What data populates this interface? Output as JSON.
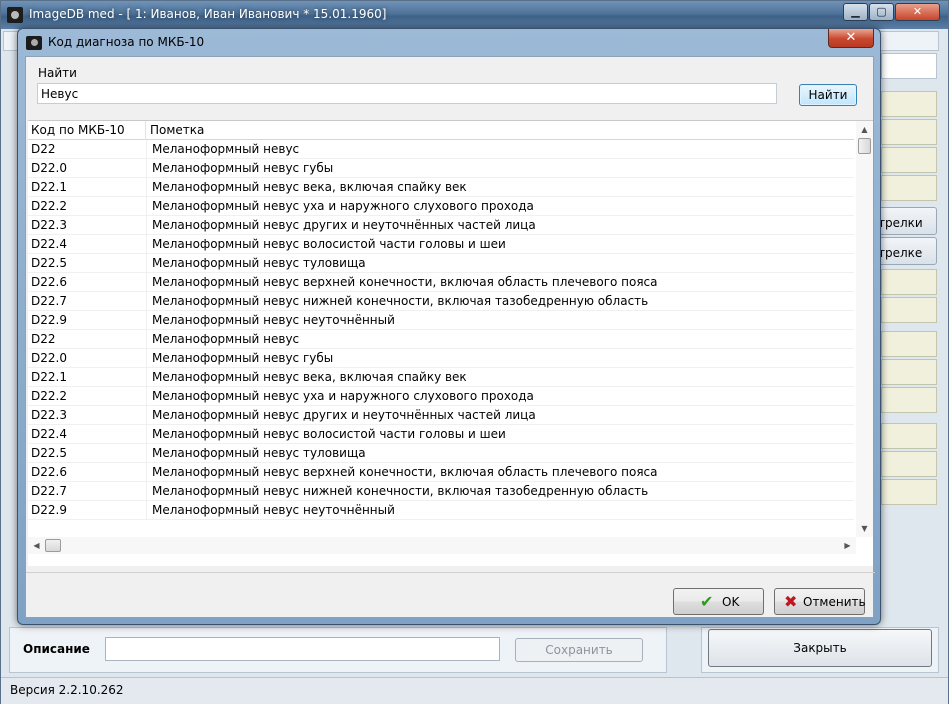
{
  "main_window": {
    "title": "ImageDB med - [ 1: Иванов, Иван Иванович   * 15.01.1960]",
    "minimize_glyph": "▁",
    "maximize_glyph": "▢",
    "close_glyph": "✕",
    "right_labels": [
      "трелки",
      "трелке"
    ],
    "description_label": "Описание",
    "save_button": "Сохранить",
    "close_button": "Закрыть",
    "status": "Версия 2.2.10.262"
  },
  "dialog": {
    "title": "Код диагноза по МКБ-10",
    "close_glyph": "✕",
    "search": {
      "label": "Найти",
      "value": "Невус",
      "button": "Найти"
    },
    "table": {
      "columns": [
        "Код по МКБ-10",
        "Пометка"
      ],
      "rows": [
        {
          "code": "D22",
          "note": "Меланоформный невус"
        },
        {
          "code": "D22.0",
          "note": "Меланоформный невус губы"
        },
        {
          "code": "D22.1",
          "note": "Меланоформный невус века, включая спайку век"
        },
        {
          "code": "D22.2",
          "note": "Меланоформный невус уха и наружного слухового прохода"
        },
        {
          "code": "D22.3",
          "note": "Меланоформный невус других и неуточнённых частей лица"
        },
        {
          "code": "D22.4",
          "note": "Меланоформный невус волосистой части головы и шеи"
        },
        {
          "code": "D22.5",
          "note": "Меланоформный невус туловища"
        },
        {
          "code": "D22.6",
          "note": "Меланоформный невус верхней конечности, включая область плечевого пояса"
        },
        {
          "code": "D22.7",
          "note": "Меланоформный невус нижней конечности, включая тазобедренную область"
        },
        {
          "code": "D22.9",
          "note": "Меланоформный невус неуточнённый"
        },
        {
          "code": "D22",
          "note": "Меланоформный невус"
        },
        {
          "code": "D22.0",
          "note": "Меланоформный невус губы"
        },
        {
          "code": "D22.1",
          "note": "Меланоформный невус века, включая спайку век"
        },
        {
          "code": "D22.2",
          "note": "Меланоформный невус уха и наружного слухового прохода"
        },
        {
          "code": "D22.3",
          "note": "Меланоформный невус других и неуточнённых частей лица"
        },
        {
          "code": "D22.4",
          "note": "Меланоформный невус волосистой части головы и шеи"
        },
        {
          "code": "D22.5",
          "note": "Меланоформный невус туловища"
        },
        {
          "code": "D22.6",
          "note": "Меланоформный невус верхней конечности, включая область плечевого пояса"
        },
        {
          "code": "D22.7",
          "note": "Меланоформный невус нижней конечности, включая тазобедренную область"
        },
        {
          "code": "D22.9",
          "note": "Меланоформный невус неуточнённый"
        }
      ]
    },
    "buttons": {
      "ok": "OK",
      "ok_icon": "✔",
      "cancel": "Отменить",
      "cancel_icon": "✖"
    }
  },
  "colors": {
    "ok_icon": "#2e9a1e",
    "cancel_icon": "#c0161d"
  }
}
